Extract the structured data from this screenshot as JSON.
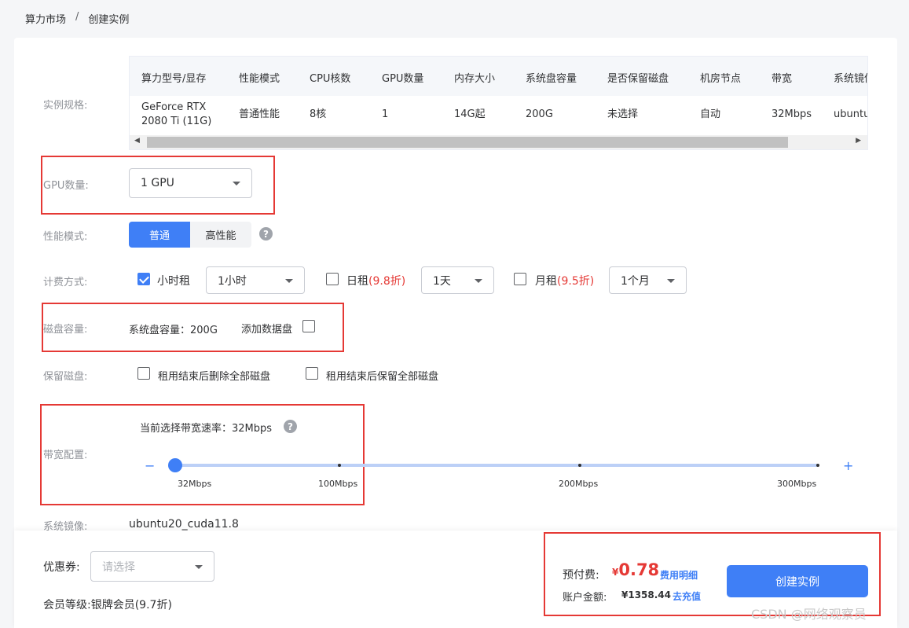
{
  "breadcrumb": {
    "parent": "算力市场",
    "separator": "/",
    "current": "创建实例"
  },
  "spec": {
    "label": "实例规格:",
    "columns": [
      "算力型号/显存",
      "性能模式",
      "CPU核数",
      "GPU数量",
      "内存大小",
      "系统盘容量",
      "是否保留磁盘",
      "机房节点",
      "带宽",
      "系统镜像"
    ],
    "row": {
      "model_line1": "GeForce RTX",
      "model_line2": "2080 Ti (11G)",
      "mode": "普通性能",
      "cpu": "8核",
      "gpu": "1",
      "memory": "14G起",
      "disk": "200G",
      "keep_disk": "未选择",
      "node": "自动",
      "bandwidth": "32Mbps",
      "image": "ubuntu"
    }
  },
  "gpu_count": {
    "label": "GPU数量:",
    "value": "1 GPU"
  },
  "perf_mode": {
    "label": "性能模式:",
    "options": [
      "普通",
      "高性能"
    ],
    "selected": "普通"
  },
  "billing": {
    "label": "计费方式:",
    "hourly": {
      "label": "小时租",
      "checked": true,
      "select": "1小时"
    },
    "daily": {
      "label": "日租",
      "discount": "(9.8折)",
      "checked": false,
      "select": "1天"
    },
    "monthly": {
      "label": "月租",
      "discount": "(9.5折)",
      "checked": false,
      "select": "1个月"
    }
  },
  "disk": {
    "label": "磁盘容量:",
    "system_disk": "系统盘容量：200G",
    "add_data_disk": "添加数据盘"
  },
  "keep_disk": {
    "label": "保留磁盘:",
    "delete_all": "租用结束后删除全部磁盘",
    "keep_all": "租用结束后保留全部磁盘"
  },
  "bandwidth": {
    "label": "带宽配置:",
    "current": "当前选择带宽速率：32Mbps",
    "ticks": [
      "32Mbps",
      "100Mbps",
      "200Mbps",
      "300Mbps"
    ],
    "value_mbps": 32,
    "range_mbps": [
      32,
      300
    ],
    "minus": "−",
    "plus": "+"
  },
  "image_row": {
    "label": "系统镜像:",
    "value": "ubuntu20_cuda11.8"
  },
  "coupon": {
    "label": "优惠券:",
    "placeholder": "请选择"
  },
  "member": {
    "label": "会员等级:",
    "value": "银牌会员(9.7折)"
  },
  "prepay": {
    "label": "预付费:",
    "currency": "¥",
    "amount": "0.78",
    "detail_link": "费用明细"
  },
  "balance": {
    "label": "账户金额:",
    "amount": "¥1358.44",
    "recharge_link": "去充值"
  },
  "create_button": "创建实例",
  "watermark": "CSDN @网络观察员",
  "colors": {
    "primary": "#3f7ff6",
    "price": "#e53935",
    "highlight_box": "#e53935"
  },
  "icons": {
    "help": "question-circle-icon",
    "dropdown": "caret-down-icon",
    "check": "check-icon"
  }
}
